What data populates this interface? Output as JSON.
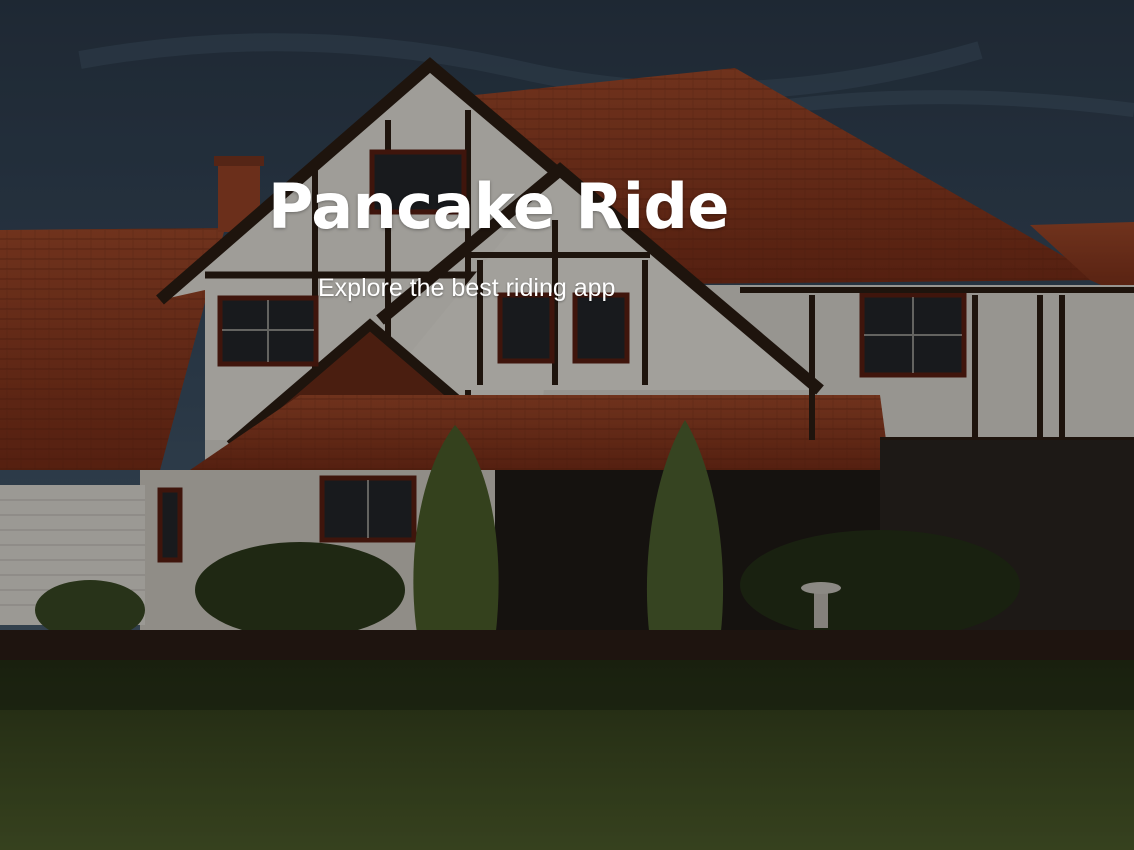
{
  "hero": {
    "title": "Pancake Ride",
    "subtitle": "Explore the best riding app"
  },
  "background": {
    "description_icon": "house-photo",
    "overlay_color": "#000000"
  },
  "colors": {
    "text": "#ffffff",
    "roof": "#8a3a1e",
    "sky": "#34475a",
    "lawn": "#3c4a1e"
  }
}
